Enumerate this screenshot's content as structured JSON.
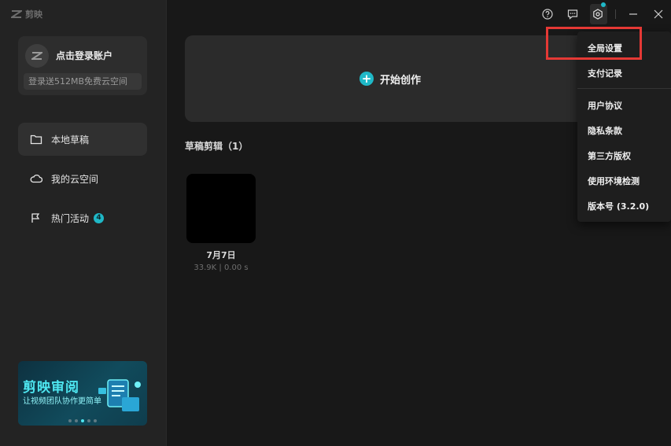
{
  "app": {
    "name": "剪映"
  },
  "account": {
    "login_label": "点击登录账户",
    "promo": "登录送512MB免费云空间"
  },
  "sidebar": {
    "items": [
      {
        "label": "本地草稿",
        "icon": "folder-icon",
        "active": true
      },
      {
        "label": "我的云空间",
        "icon": "cloud-icon",
        "active": false
      },
      {
        "label": "热门活动",
        "icon": "flag-icon",
        "active": false,
        "badge": "4"
      }
    ]
  },
  "banner": {
    "title": "剪映审阅",
    "subtitle": "让视频团队协作更简单"
  },
  "main": {
    "create_label": "开始创作",
    "drafts_section": "草稿剪辑（1）",
    "drafts": [
      {
        "name": "7月7日",
        "meta": "33.9K | 0.00 s"
      }
    ]
  },
  "menu": {
    "items": [
      "全局设置",
      "支付记录",
      "用户协议",
      "隐私条款",
      "第三方版权",
      "使用环境检测",
      "版本号 (3.2.0)"
    ]
  },
  "colors": {
    "accent": "#1fb8c7",
    "highlight": "#e53935"
  }
}
